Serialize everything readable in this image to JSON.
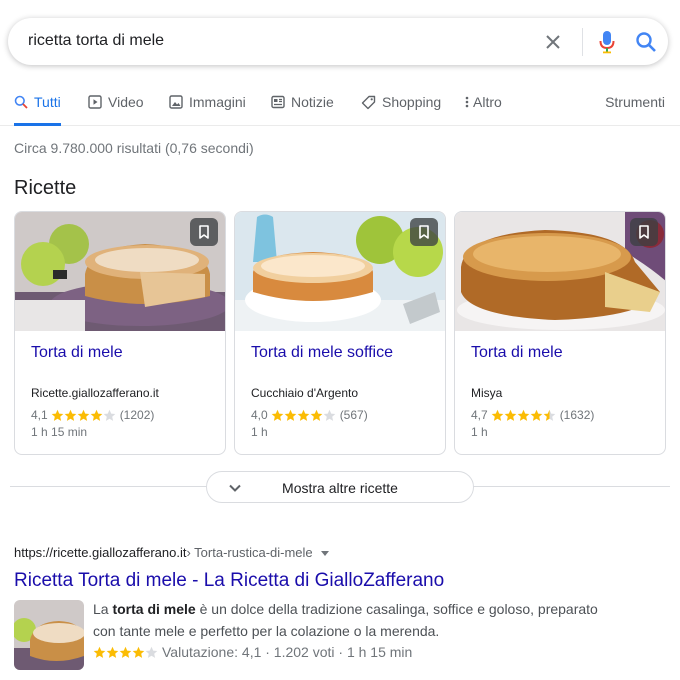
{
  "search": {
    "query": "ricetta torta di mele"
  },
  "tabs": [
    {
      "label": "Tutti",
      "icon": "search-icon",
      "active": true
    },
    {
      "label": "Video",
      "icon": "video-icon"
    },
    {
      "label": "Immagini",
      "icon": "image-icon"
    },
    {
      "label": "Notizie",
      "icon": "news-icon"
    },
    {
      "label": "Shopping",
      "icon": "tag-icon"
    },
    {
      "label": "Altro",
      "icon": "more-vert-icon"
    }
  ],
  "tools_label": "Strumenti",
  "stats": "Circa 9.780.000 risultati (0,76 secondi)",
  "recipes": {
    "title": "Ricette",
    "cards": [
      {
        "title": "Torta di mele",
        "source": "Ricette.giallozafferano.it",
        "rating": "4,1",
        "rating_value": 4.1,
        "count": "(1202)",
        "time": "1 h 15 min"
      },
      {
        "title": "Torta di mele soffice",
        "source": "Cucchiaio d'Argento",
        "rating": "4,0",
        "rating_value": 4.0,
        "count": "(567)",
        "time": "1 h"
      },
      {
        "title": "Torta di mele",
        "source": "Misya",
        "rating": "4,7",
        "rating_value": 4.7,
        "count": "(1632)",
        "time": "1 h"
      }
    ],
    "more_label": "Mostra altre ricette"
  },
  "result": {
    "url": "https://ricette.giallozafferano.it",
    "breadcrumb": " › Torta-rustica-di-mele",
    "title": "Ricetta Torta di mele - La Ricetta di GialloZafferano",
    "snippet_pre": "La ",
    "snippet_bold": "torta di mele",
    "snippet_post": " è un dolce della tradizione casalinga, soffice e goloso, preparato con tante mele e perfetto per la colazione o la merenda.",
    "rating_value": 4.1,
    "meta": "Valutazione: 4,1 · 1.202 voti · 1 h 15 min"
  },
  "colors": {
    "link": "#1a0dab",
    "accent": "#1a73e8",
    "star": "#fbbc04"
  }
}
